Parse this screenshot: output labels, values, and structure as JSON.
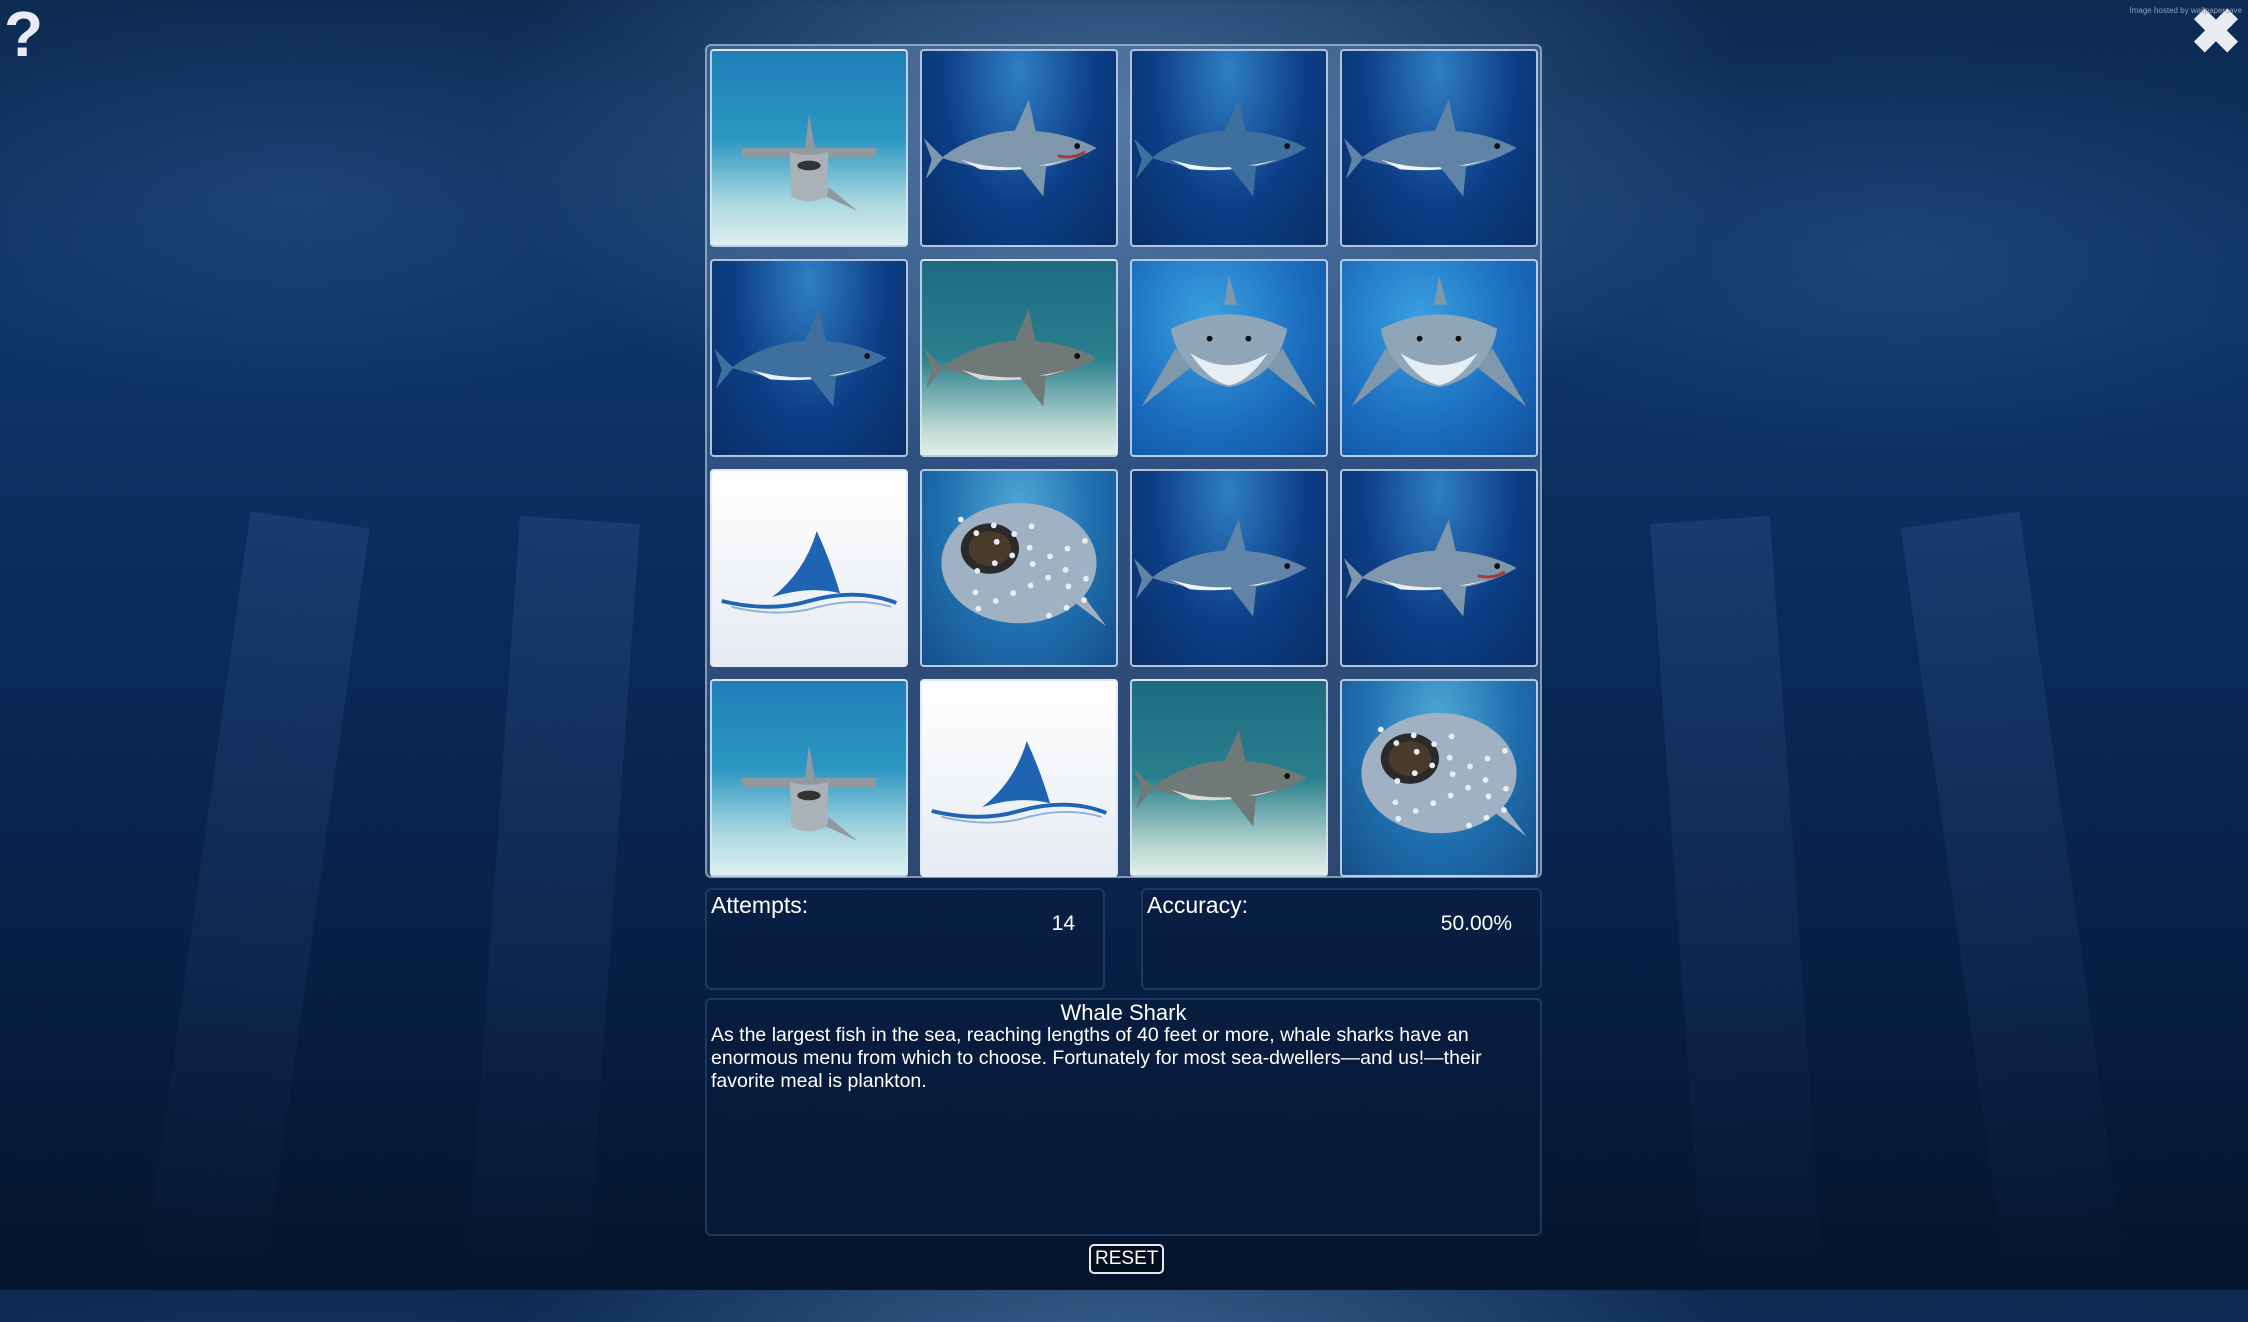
{
  "header": {
    "help_icon": "?",
    "close_icon": "✖",
    "credit": "Image hosted by wallpapercave"
  },
  "cards": [
    {
      "state": "face-up",
      "species": "hammerhead-shark"
    },
    {
      "state": "face-up",
      "species": "great-white-shark"
    },
    {
      "state": "face-up",
      "species": "mako-shark"
    },
    {
      "state": "face-up",
      "species": "mako-shark-side"
    },
    {
      "state": "face-up",
      "species": "mako-shark"
    },
    {
      "state": "face-up",
      "species": "tiger-shark"
    },
    {
      "state": "face-up",
      "species": "bull-shark"
    },
    {
      "state": "face-up",
      "species": "bull-shark"
    },
    {
      "state": "face-down",
      "species": "shark-fin-logo"
    },
    {
      "state": "face-up",
      "species": "whale-shark"
    },
    {
      "state": "face-up",
      "species": "mako-shark-side"
    },
    {
      "state": "face-up",
      "species": "great-white-shark"
    },
    {
      "state": "face-up",
      "species": "hammerhead-shark"
    },
    {
      "state": "face-down",
      "species": "shark-fin-logo"
    },
    {
      "state": "face-up",
      "species": "tiger-shark"
    },
    {
      "state": "face-up",
      "species": "whale-shark"
    }
  ],
  "stats": {
    "attempts_label": "Attempts:",
    "attempts_value": "14",
    "accuracy_label": "Accuracy:",
    "accuracy_value": "50.00%"
  },
  "info": {
    "title": "Whale Shark",
    "body": "As the largest fish in the sea, reaching lengths of 40 feet or more, whale sharks have an enormous menu from which to choose. Fortunately for most sea-dwellers—and us!—their favorite meal is plankton."
  },
  "controls": {
    "reset_label": "RESET"
  },
  "colors": {
    "logo_fin": "#1f63b3",
    "logo_wave": "#1f63b3"
  }
}
